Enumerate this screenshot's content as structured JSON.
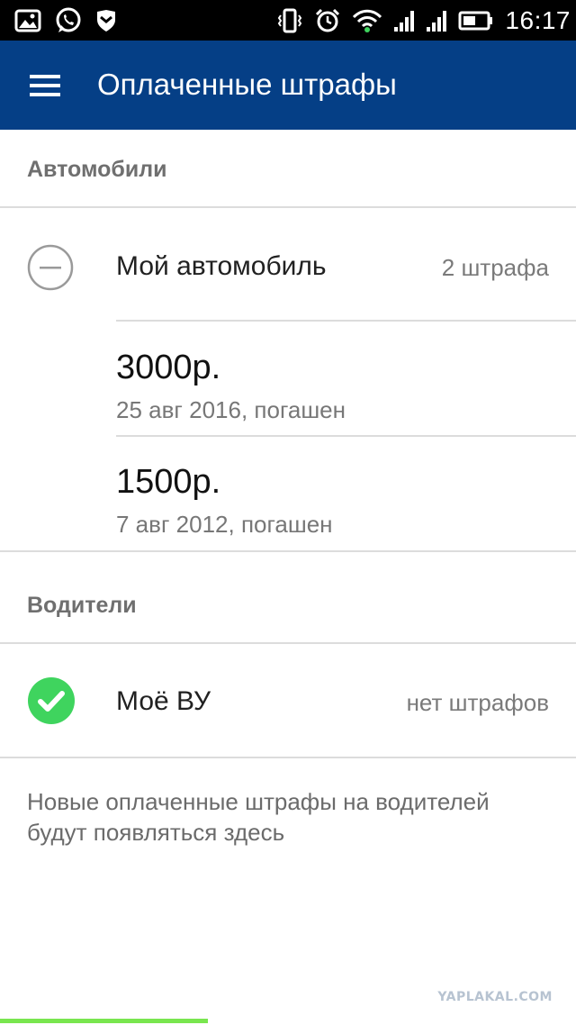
{
  "status_bar": {
    "time": "16:17",
    "left_icons": [
      "image-icon",
      "whatsapp-icon",
      "shield-icon"
    ],
    "right_icons": [
      "vibrate-icon",
      "alarm-icon",
      "wifi-icon",
      "signal-icon",
      "signal-icon-2",
      "battery-icon"
    ]
  },
  "app_bar": {
    "title": "Оплаченные штрафы",
    "background": "#053f86"
  },
  "cars": {
    "section_title": "Автомобили",
    "vehicle": {
      "name": "Мой автомобиль",
      "count": "2 штрафа",
      "fines": [
        {
          "amount": "3000р.",
          "date": "25 авг 2016, погашен"
        },
        {
          "amount": "1500р.",
          "date": "7 авг 2012, погашен"
        }
      ]
    }
  },
  "drivers": {
    "section_title": "Водители",
    "license": {
      "name": "Моё ВУ",
      "status": "нет штрафов",
      "accent": "#3fd45e"
    },
    "hint": "Новые оплаченные штрафы на водителей будут появляться здесь"
  },
  "watermark": "YAPLAKAL.COM",
  "progress_bar": {
    "color": "#79e64f"
  }
}
